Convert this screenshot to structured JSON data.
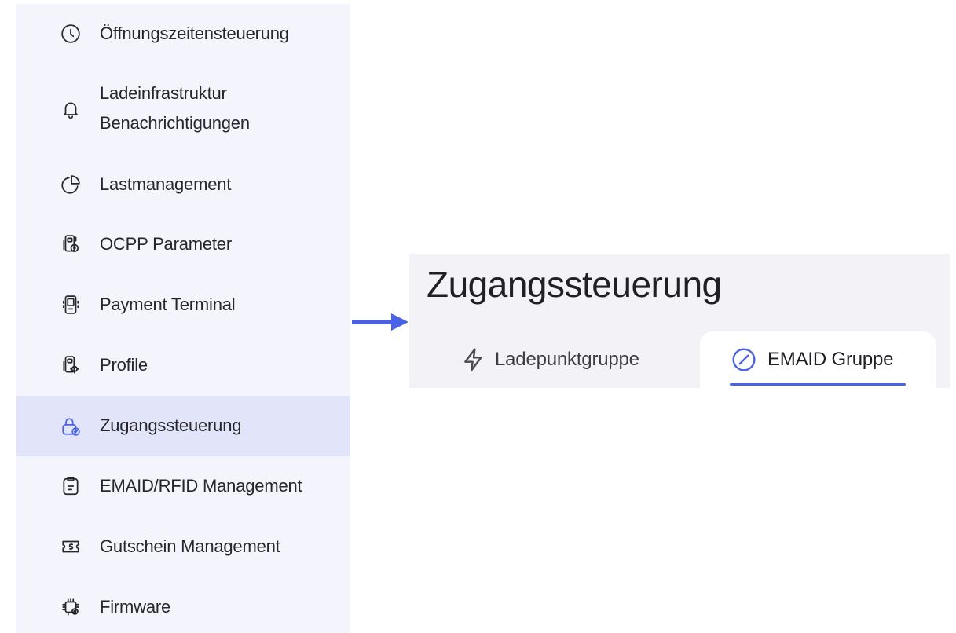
{
  "sidebar": {
    "items": [
      {
        "label": "Öffnungszeitensteuerung",
        "icon": "clock-icon"
      },
      {
        "label_line1": "Ladeinfrastruktur",
        "label_line2": "Benachrichtigungen",
        "icon": "bell-icon"
      },
      {
        "label": "Lastmanagement",
        "icon": "pie-chart-icon"
      },
      {
        "label": "OCPP Parameter",
        "icon": "charger-settings-icon"
      },
      {
        "label": "Payment Terminal",
        "icon": "payment-terminal-icon"
      },
      {
        "label": "Profile",
        "icon": "charger-profile-icon"
      },
      {
        "label": "Zugangssteuerung",
        "icon": "lock-check-icon",
        "active": true
      },
      {
        "label": "EMAID/RFID Management",
        "icon": "clipboard-icon"
      },
      {
        "label": "Gutschein Management",
        "icon": "voucher-icon"
      },
      {
        "label": "Firmware",
        "icon": "chip-gear-icon"
      }
    ]
  },
  "arrow": {
    "icon": "arrow-right-icon",
    "color": "#4a63e6"
  },
  "detail": {
    "title": "Zugangssteuerung",
    "tabs": [
      {
        "label": "Ladepunktgruppe",
        "icon": "lightning-icon",
        "active": false
      },
      {
        "label": "EMAID Gruppe",
        "icon": "no-entry-circle-icon",
        "active": true
      }
    ]
  },
  "colors": {
    "accent": "#4a63e6",
    "sidebar_bg": "#f4f4fc",
    "sidebar_active_bg": "#e2e4fa",
    "panel_bg": "#f2f2f7"
  }
}
